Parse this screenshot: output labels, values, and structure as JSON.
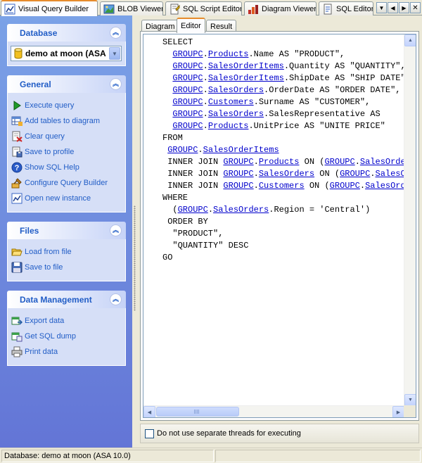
{
  "top_tabs": [
    {
      "label": "Visual Query Builder",
      "icon": "query-builder-icon",
      "active": true
    },
    {
      "label": "BLOB Viewer",
      "icon": "blob-viewer-icon",
      "active": false
    },
    {
      "label": "SQL Script Editor",
      "icon": "sql-script-icon",
      "active": false
    },
    {
      "label": "Diagram Viewer",
      "icon": "diagram-viewer-icon",
      "active": false
    },
    {
      "label": "SQL Editor:",
      "icon": "sql-editor-icon",
      "active": false
    }
  ],
  "left_pane": {
    "database": {
      "title": "Database",
      "selected": "demo at moon (ASA"
    },
    "general": {
      "title": "General",
      "items": [
        {
          "label": "Execute query",
          "icon": "play-icon"
        },
        {
          "label": "Add tables to diagram",
          "icon": "table-add-icon"
        },
        {
          "label": "Clear query",
          "icon": "clear-icon"
        },
        {
          "label": "Save to profile",
          "icon": "save-profile-icon"
        },
        {
          "label": "Show SQL Help",
          "icon": "help-icon"
        },
        {
          "label": "Configure Query Builder",
          "icon": "configure-icon"
        },
        {
          "label": "Open new instance",
          "icon": "chart-icon"
        }
      ]
    },
    "files": {
      "title": "Files",
      "items": [
        {
          "label": "Load from file",
          "icon": "folder-open-icon"
        },
        {
          "label": "Save to file",
          "icon": "floppy-icon"
        }
      ]
    },
    "data_management": {
      "title": "Data Management",
      "items": [
        {
          "label": "Export data",
          "icon": "export-icon"
        },
        {
          "label": "Get SQL dump",
          "icon": "dump-icon"
        },
        {
          "label": "Print data",
          "icon": "printer-icon"
        }
      ]
    }
  },
  "editor": {
    "tabs": [
      {
        "label": "Diagram",
        "active": false
      },
      {
        "label": "Editor",
        "active": true
      },
      {
        "label": "Result",
        "active": false
      }
    ],
    "code_lines": [
      [
        {
          "t": "SELECT"
        }
      ],
      [
        {
          "t": "  "
        },
        {
          "t": "GROUPC",
          "o": 1
        },
        {
          "t": "."
        },
        {
          "t": "Products",
          "o": 1
        },
        {
          "t": ".Name AS \"PRODUCT\","
        }
      ],
      [
        {
          "t": "  "
        },
        {
          "t": "GROUPC",
          "o": 1
        },
        {
          "t": "."
        },
        {
          "t": "SalesOrderItems",
          "o": 1
        },
        {
          "t": ".Quantity AS \"QUANTITY\","
        }
      ],
      [
        {
          "t": "  "
        },
        {
          "t": "GROUPC",
          "o": 1
        },
        {
          "t": "."
        },
        {
          "t": "SalesOrderItems",
          "o": 1
        },
        {
          "t": ".ShipDate AS \"SHIP DATE\","
        }
      ],
      [
        {
          "t": "  "
        },
        {
          "t": "GROUPC",
          "o": 1
        },
        {
          "t": "."
        },
        {
          "t": "SalesOrders",
          "o": 1
        },
        {
          "t": ".OrderDate AS \"ORDER DATE\","
        }
      ],
      [
        {
          "t": "  "
        },
        {
          "t": "GROUPC",
          "o": 1
        },
        {
          "t": "."
        },
        {
          "t": "Customers",
          "o": 1
        },
        {
          "t": ".Surname AS \"CUSTOMER\","
        }
      ],
      [
        {
          "t": "  "
        },
        {
          "t": "GROUPC",
          "o": 1
        },
        {
          "t": "."
        },
        {
          "t": "SalesOrders",
          "o": 1
        },
        {
          "t": ".SalesRepresentative AS"
        }
      ],
      [
        {
          "t": "  "
        },
        {
          "t": "GROUPC",
          "o": 1
        },
        {
          "t": "."
        },
        {
          "t": "Products",
          "o": 1
        },
        {
          "t": ".UnitPrice AS \"UNITE PRICE\""
        }
      ],
      [
        {
          "t": "FROM"
        }
      ],
      [
        {
          "t": " "
        },
        {
          "t": "GROUPC",
          "o": 1
        },
        {
          "t": "."
        },
        {
          "t": "SalesOrderItems",
          "o": 1
        }
      ],
      [
        {
          "t": " INNER JOIN "
        },
        {
          "t": "GROUPC",
          "o": 1
        },
        {
          "t": "."
        },
        {
          "t": "Products",
          "o": 1
        },
        {
          "t": " ON ("
        },
        {
          "t": "GROUPC",
          "o": 1
        },
        {
          "t": "."
        },
        {
          "t": "SalesOrderItems",
          "o": 1
        }
      ],
      [
        {
          "t": " INNER JOIN "
        },
        {
          "t": "GROUPC",
          "o": 1
        },
        {
          "t": "."
        },
        {
          "t": "SalesOrders",
          "o": 1
        },
        {
          "t": " ON ("
        },
        {
          "t": "GROUPC",
          "o": 1
        },
        {
          "t": "."
        },
        {
          "t": "SalesOrderItems",
          "o": 1
        }
      ],
      [
        {
          "t": " INNER JOIN "
        },
        {
          "t": "GROUPC",
          "o": 1
        },
        {
          "t": "."
        },
        {
          "t": "Customers",
          "o": 1
        },
        {
          "t": " ON ("
        },
        {
          "t": "GROUPC",
          "o": 1
        },
        {
          "t": "."
        },
        {
          "t": "SalesOrders",
          "o": 1
        }
      ],
      [
        {
          "t": "WHERE"
        }
      ],
      [
        {
          "t": "  ("
        },
        {
          "t": "GROUPC",
          "o": 1
        },
        {
          "t": "."
        },
        {
          "t": "SalesOrders",
          "o": 1
        },
        {
          "t": ".Region = 'Central')"
        }
      ],
      [
        {
          "t": " ORDER BY"
        }
      ],
      [
        {
          "t": "  \"PRODUCT\","
        }
      ],
      [
        {
          "t": "  \"QUANTITY\" DESC"
        }
      ],
      [
        {
          "t": "GO"
        }
      ]
    ],
    "threads_checkbox_label": "Do not use separate threads for executing",
    "threads_checked": false
  },
  "status_bar": {
    "text": "Database: demo at moon (ASA 10.0)"
  },
  "colors": {
    "accent_orange": "#e68b2c",
    "task_link": "#215dc6",
    "code_object": "#0000cc"
  }
}
